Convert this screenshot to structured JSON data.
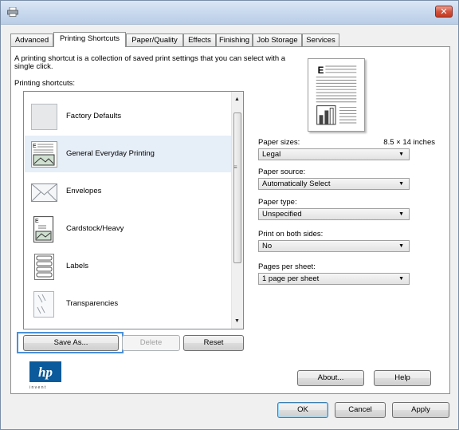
{
  "tabs": [
    "Advanced",
    "Printing Shortcuts",
    "Paper/Quality",
    "Effects",
    "Finishing",
    "Job Storage",
    "Services"
  ],
  "description": "A printing shortcut is a collection of saved print settings that you can select with a single click.",
  "shortcuts_label": "Printing shortcuts:",
  "shortcuts": [
    {
      "label": "Factory Defaults",
      "icon": "blank-page-icon"
    },
    {
      "label": "General Everyday Printing",
      "icon": "document-landscape-icon"
    },
    {
      "label": "Envelopes",
      "icon": "envelope-icon"
    },
    {
      "label": "Cardstock/Heavy",
      "icon": "cardstock-icon"
    },
    {
      "label": "Labels",
      "icon": "labels-icon"
    },
    {
      "label": "Transparencies",
      "icon": "transparency-icon"
    }
  ],
  "buttons": {
    "save_as": "Save As...",
    "delete": "Delete",
    "reset": "Reset",
    "about": "About...",
    "help": "Help",
    "ok": "OK",
    "cancel": "Cancel",
    "apply": "Apply"
  },
  "settings": {
    "paper_sizes_label": "Paper sizes:",
    "paper_sizes_dims": "8.5 × 14 inches",
    "paper_sizes_value": "Legal",
    "paper_source_label": "Paper source:",
    "paper_source_value": "Automatically Select",
    "paper_type_label": "Paper type:",
    "paper_type_value": "Unspecified",
    "duplex_label": "Print on both sides:",
    "duplex_value": "No",
    "pages_label": "Pages per sheet:",
    "pages_value": "1 page per sheet"
  },
  "logo": {
    "text": "hp",
    "tagline": "i n v e n t"
  },
  "colors": {
    "accent": "#4a90d9",
    "hp_blue": "#0a5a9c",
    "close_red": "#c23b22"
  }
}
